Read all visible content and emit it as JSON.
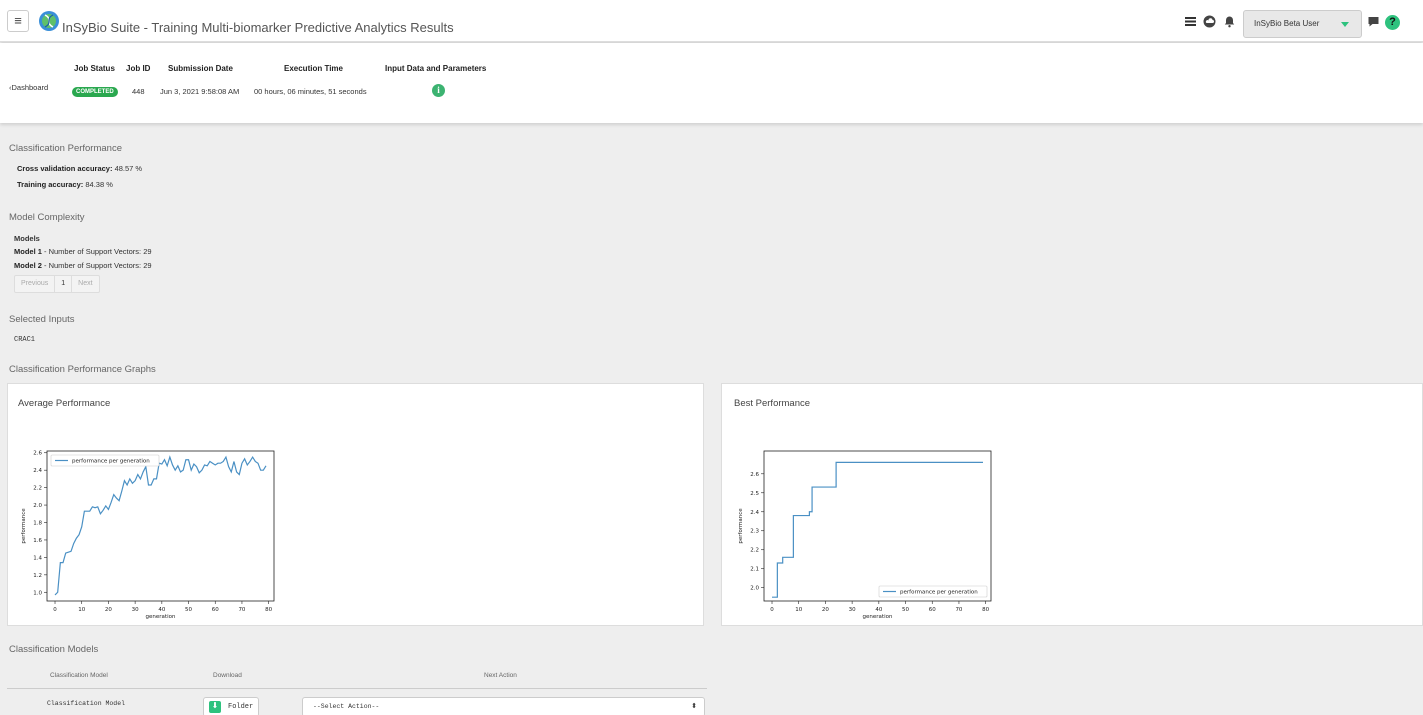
{
  "topbar": {
    "title": "InSyBio Suite - Training Multi-biomarker Predictive Analytics Results",
    "user": "InSyBio Beta User",
    "help": "?"
  },
  "job": {
    "back_label": "Dashboard",
    "headers": [
      "Job Status",
      "Job ID",
      "Submission Date",
      "Execution Time",
      "Input Data and Parameters"
    ],
    "status": "COMPLETED",
    "id": "448",
    "submission_date": "Jun 3, 2021 9:58:08 AM",
    "execution_time": "00 hours, 06 minutes, 51 seconds"
  },
  "classification_performance": {
    "title": "Classification Performance",
    "cv_label": "Cross validation accuracy:",
    "cv_value": "48.57 %",
    "train_label": "Training accuracy:",
    "train_value": "84.38 %"
  },
  "model_complexity": {
    "title": "Model Complexity",
    "models_label": "Models",
    "model1_label": "Model 1",
    "model1_text": "- Number of Support Vectors: 29",
    "model2_label": "Model 2",
    "model2_text": "- Number of Support Vectors: 29",
    "pager": {
      "prev": "Previous",
      "page": "1",
      "next": "Next"
    }
  },
  "selected_inputs": {
    "title": "Selected Inputs",
    "value": "CRAC1"
  },
  "graphs": {
    "title": "Classification Performance Graphs",
    "average_title": "Average Performance",
    "best_title": "Best Performance"
  },
  "chart_data": [
    {
      "type": "line",
      "title": "",
      "xlabel": "generation",
      "ylabel": "performance",
      "xlim": [
        -3,
        82
      ],
      "ylim": [
        0.9,
        2.62
      ],
      "xticks": [
        0,
        10,
        20,
        30,
        40,
        50,
        60,
        70,
        80
      ],
      "yticks": [
        1.0,
        1.2,
        1.4,
        1.6,
        1.8,
        2.0,
        2.2,
        2.4,
        2.6
      ],
      "legend_position": "top-left",
      "series": [
        {
          "name": "performance per generation",
          "color": "#4a90c4",
          "x": [
            0,
            1,
            2,
            3,
            4,
            5,
            6,
            7,
            8,
            9,
            10,
            11,
            12,
            13,
            14,
            15,
            16,
            17,
            18,
            19,
            20,
            21,
            22,
            23,
            24,
            25,
            26,
            27,
            28,
            29,
            30,
            31,
            32,
            33,
            34,
            35,
            36,
            37,
            38,
            39,
            40,
            41,
            42,
            43,
            44,
            45,
            46,
            47,
            48,
            49,
            50,
            51,
            52,
            53,
            54,
            55,
            56,
            57,
            58,
            59,
            60,
            61,
            62,
            63,
            64,
            65,
            66,
            67,
            68,
            69,
            70,
            71,
            72,
            73,
            74,
            75,
            76,
            77,
            78,
            79
          ],
          "values": [
            0.97,
            1.0,
            1.34,
            1.34,
            1.45,
            1.46,
            1.47,
            1.56,
            1.62,
            1.66,
            1.75,
            1.93,
            1.93,
            1.93,
            1.98,
            1.97,
            1.98,
            1.9,
            1.94,
            1.99,
            1.95,
            2.03,
            2.12,
            2.08,
            2.05,
            2.16,
            2.28,
            2.23,
            2.3,
            2.25,
            2.28,
            2.35,
            2.3,
            2.38,
            2.44,
            2.23,
            2.23,
            2.3,
            2.3,
            2.48,
            2.47,
            2.52,
            2.45,
            2.55,
            2.46,
            2.4,
            2.45,
            2.38,
            2.4,
            2.52,
            2.52,
            2.4,
            2.47,
            2.44,
            2.37,
            2.4,
            2.46,
            2.45,
            2.5,
            2.48,
            2.46,
            2.48,
            2.48,
            2.5,
            2.55,
            2.44,
            2.38,
            2.5,
            2.38,
            2.35,
            2.48,
            2.53,
            2.46,
            2.5,
            2.55,
            2.5,
            2.48,
            2.4,
            2.4,
            2.45
          ]
        }
      ]
    },
    {
      "type": "line",
      "title": "",
      "xlabel": "generation",
      "ylabel": "performance",
      "xlim": [
        -3,
        82
      ],
      "ylim": [
        1.93,
        2.72
      ],
      "xticks": [
        0,
        10,
        20,
        30,
        40,
        50,
        60,
        70,
        80
      ],
      "yticks": [
        2.0,
        2.1,
        2.2,
        2.3,
        2.4,
        2.5,
        2.6
      ],
      "legend_position": "bottom-right",
      "series": [
        {
          "name": "performance per generation",
          "color": "#4a90c4",
          "x": [
            0,
            1,
            2,
            3,
            4,
            5,
            6,
            7,
            8,
            9,
            10,
            11,
            12,
            13,
            14,
            15,
            16,
            17,
            18,
            19,
            20,
            21,
            22,
            23,
            24,
            79
          ],
          "values": [
            1.95,
            1.95,
            2.13,
            2.13,
            2.16,
            2.16,
            2.16,
            2.16,
            2.38,
            2.38,
            2.38,
            2.38,
            2.38,
            2.38,
            2.4,
            2.53,
            2.53,
            2.53,
            2.53,
            2.53,
            2.53,
            2.53,
            2.53,
            2.53,
            2.66,
            2.66
          ]
        }
      ]
    }
  ],
  "models": {
    "title": "Classification Models",
    "headers": [
      "Classification Model",
      "Download",
      "Next Action"
    ],
    "row_model": "Classification Model",
    "folder_label": "Folder",
    "action_placeholder": "--Select Action--"
  }
}
